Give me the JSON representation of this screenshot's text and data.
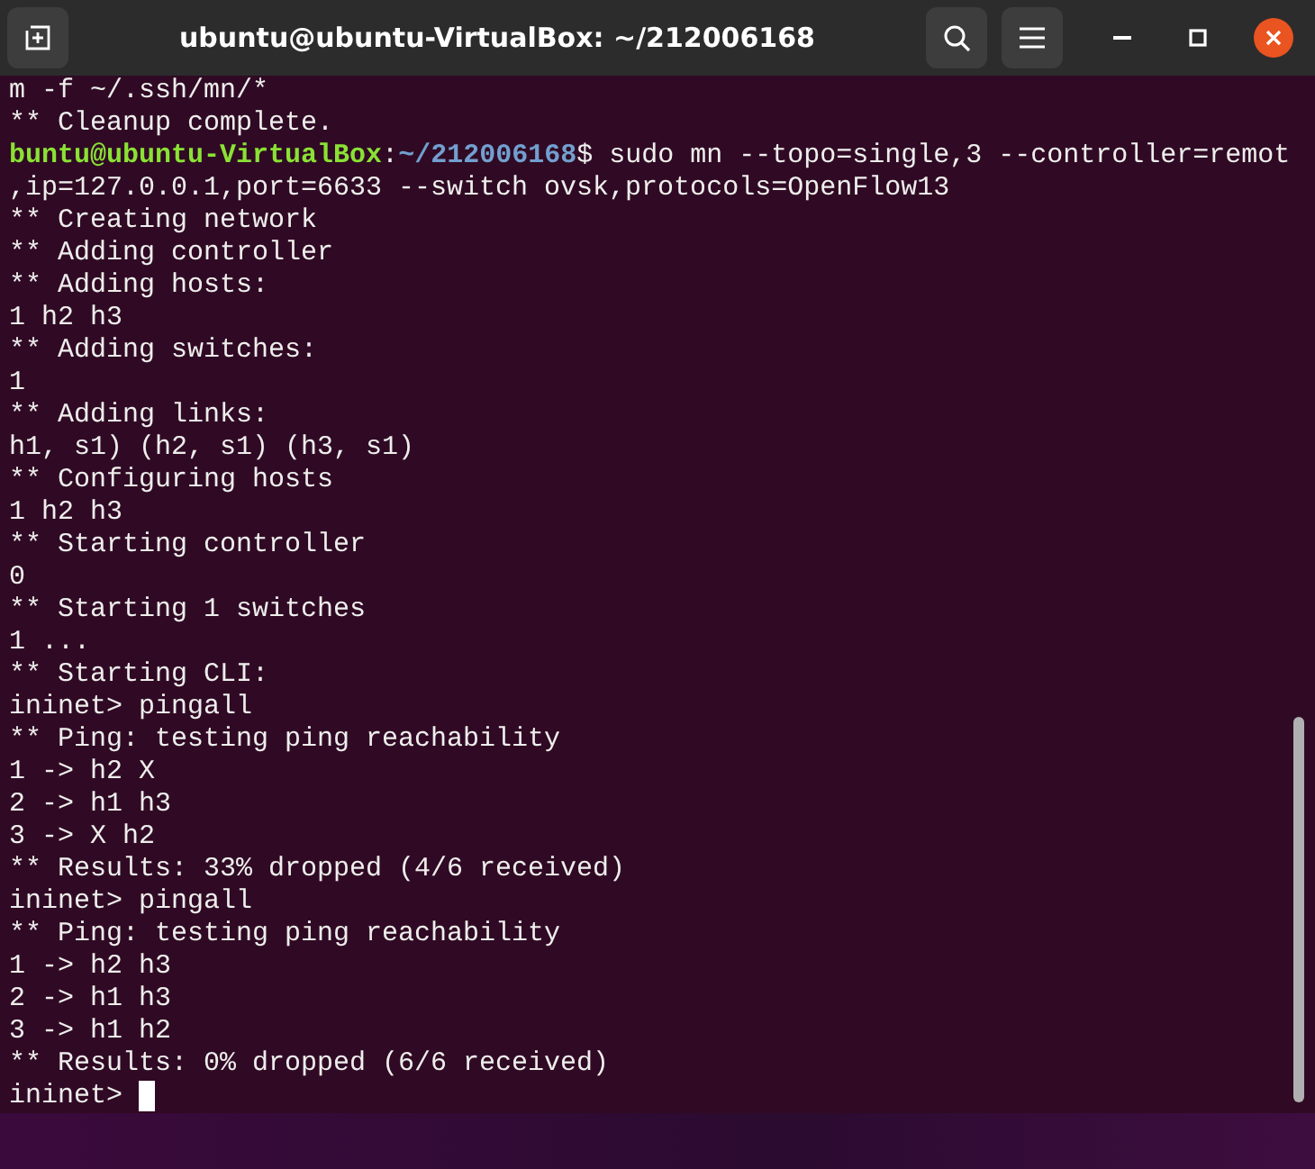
{
  "window": {
    "title": "ubuntu@ubuntu-VirtualBox: ~/212006168"
  },
  "terminal": {
    "lines": [
      {
        "kind": "text",
        "text": "m -f ~/.ssh/mn/*"
      },
      {
        "kind": "text",
        "text": "** Cleanup complete."
      },
      {
        "kind": "prompt",
        "user_host": "buntu@ubuntu-VirtualBox",
        "separator": ":",
        "path": "~/212006168",
        "command": "$ sudo mn --topo=single,3 --controller=remot"
      },
      {
        "kind": "text",
        "text": ",ip=127.0.0.1,port=6633 --switch ovsk,protocols=OpenFlow13"
      },
      {
        "kind": "text",
        "text": "** Creating network"
      },
      {
        "kind": "text",
        "text": "** Adding controller"
      },
      {
        "kind": "text",
        "text": "** Adding hosts:"
      },
      {
        "kind": "text",
        "text": "1 h2 h3"
      },
      {
        "kind": "text",
        "text": "** Adding switches:"
      },
      {
        "kind": "text",
        "text": "1"
      },
      {
        "kind": "text",
        "text": "** Adding links:"
      },
      {
        "kind": "text",
        "text": "h1, s1) (h2, s1) (h3, s1)"
      },
      {
        "kind": "text",
        "text": "** Configuring hosts"
      },
      {
        "kind": "text",
        "text": "1 h2 h3"
      },
      {
        "kind": "text",
        "text": "** Starting controller"
      },
      {
        "kind": "text",
        "text": "0"
      },
      {
        "kind": "text",
        "text": "** Starting 1 switches"
      },
      {
        "kind": "text",
        "text": "1 ..."
      },
      {
        "kind": "text",
        "text": "** Starting CLI:"
      },
      {
        "kind": "text",
        "text": "ininet> pingall"
      },
      {
        "kind": "text",
        "text": "** Ping: testing ping reachability"
      },
      {
        "kind": "text",
        "text": "1 -> h2 X"
      },
      {
        "kind": "text",
        "text": "2 -> h1 h3"
      },
      {
        "kind": "text",
        "text": "3 -> X h2"
      },
      {
        "kind": "text",
        "text": "** Results: 33% dropped (4/6 received)"
      },
      {
        "kind": "text",
        "text": "ininet> pingall"
      },
      {
        "kind": "text",
        "text": "** Ping: testing ping reachability"
      },
      {
        "kind": "text",
        "text": "1 -> h2 h3"
      },
      {
        "kind": "text",
        "text": "2 -> h1 h3"
      },
      {
        "kind": "text",
        "text": "3 -> h1 h2"
      },
      {
        "kind": "text",
        "text": "** Results: 0% dropped (6/6 received)"
      },
      {
        "kind": "text",
        "text": "ininet>",
        "cursor": true
      }
    ]
  }
}
